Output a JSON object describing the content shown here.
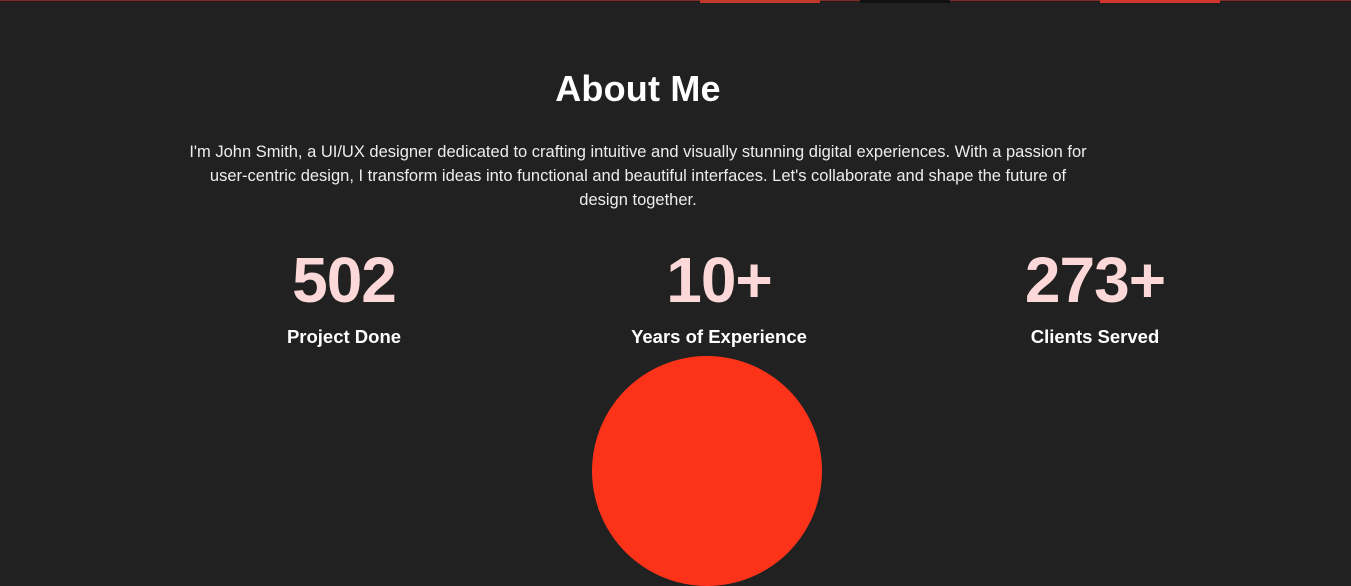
{
  "about": {
    "title": "About Me",
    "intro": "I'm John Smith, a UI/UX designer dedicated to crafting intuitive and visually stunning digital experiences. With a passion for user-centric design, I transform ideas into functional and beautiful interfaces. Let's collaborate and shape the future of design together."
  },
  "stats": [
    {
      "number": "502",
      "label": "Project Done"
    },
    {
      "number": "10+",
      "label": "Years of Experience"
    },
    {
      "number": "273+",
      "label": "Clients Served"
    }
  ],
  "colors": {
    "background": "#212121",
    "stat_number": "#fcd8d8",
    "accent": "#fc3319"
  }
}
